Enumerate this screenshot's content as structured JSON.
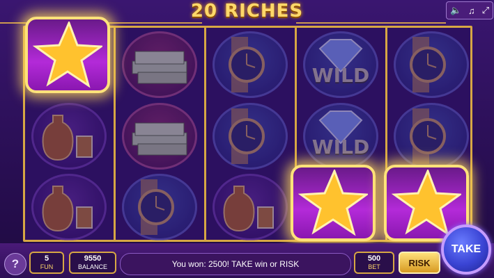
{
  "header": {
    "title": "20 RICHES",
    "sound_icon": "speaker-icon",
    "music_icon": "music-note-icon",
    "fullscreen_icon": "fullscreen-icon"
  },
  "reels": [
    [
      "star",
      "cognac",
      "cognac"
    ],
    [
      "money",
      "money",
      "watch"
    ],
    [
      "watch",
      "watch",
      "cognac"
    ],
    [
      "wild",
      "wild",
      "star"
    ],
    [
      "watch",
      "watch",
      "star"
    ]
  ],
  "symbols": {
    "wild_label": "WILD"
  },
  "bottom": {
    "help_label": "?",
    "lines_value": "5",
    "lines_label": "FUN",
    "balance_value": "9550",
    "balance_label": "BALANCE",
    "message": "You won: 2500! TAKE win or RISK",
    "bet_value": "500",
    "bet_label": "BET",
    "risk_label": "RISK",
    "take_label": "TAKE"
  },
  "colors": {
    "gold": "#d7a744",
    "background": "#2a0f55",
    "take_button": "#3a44d4"
  }
}
